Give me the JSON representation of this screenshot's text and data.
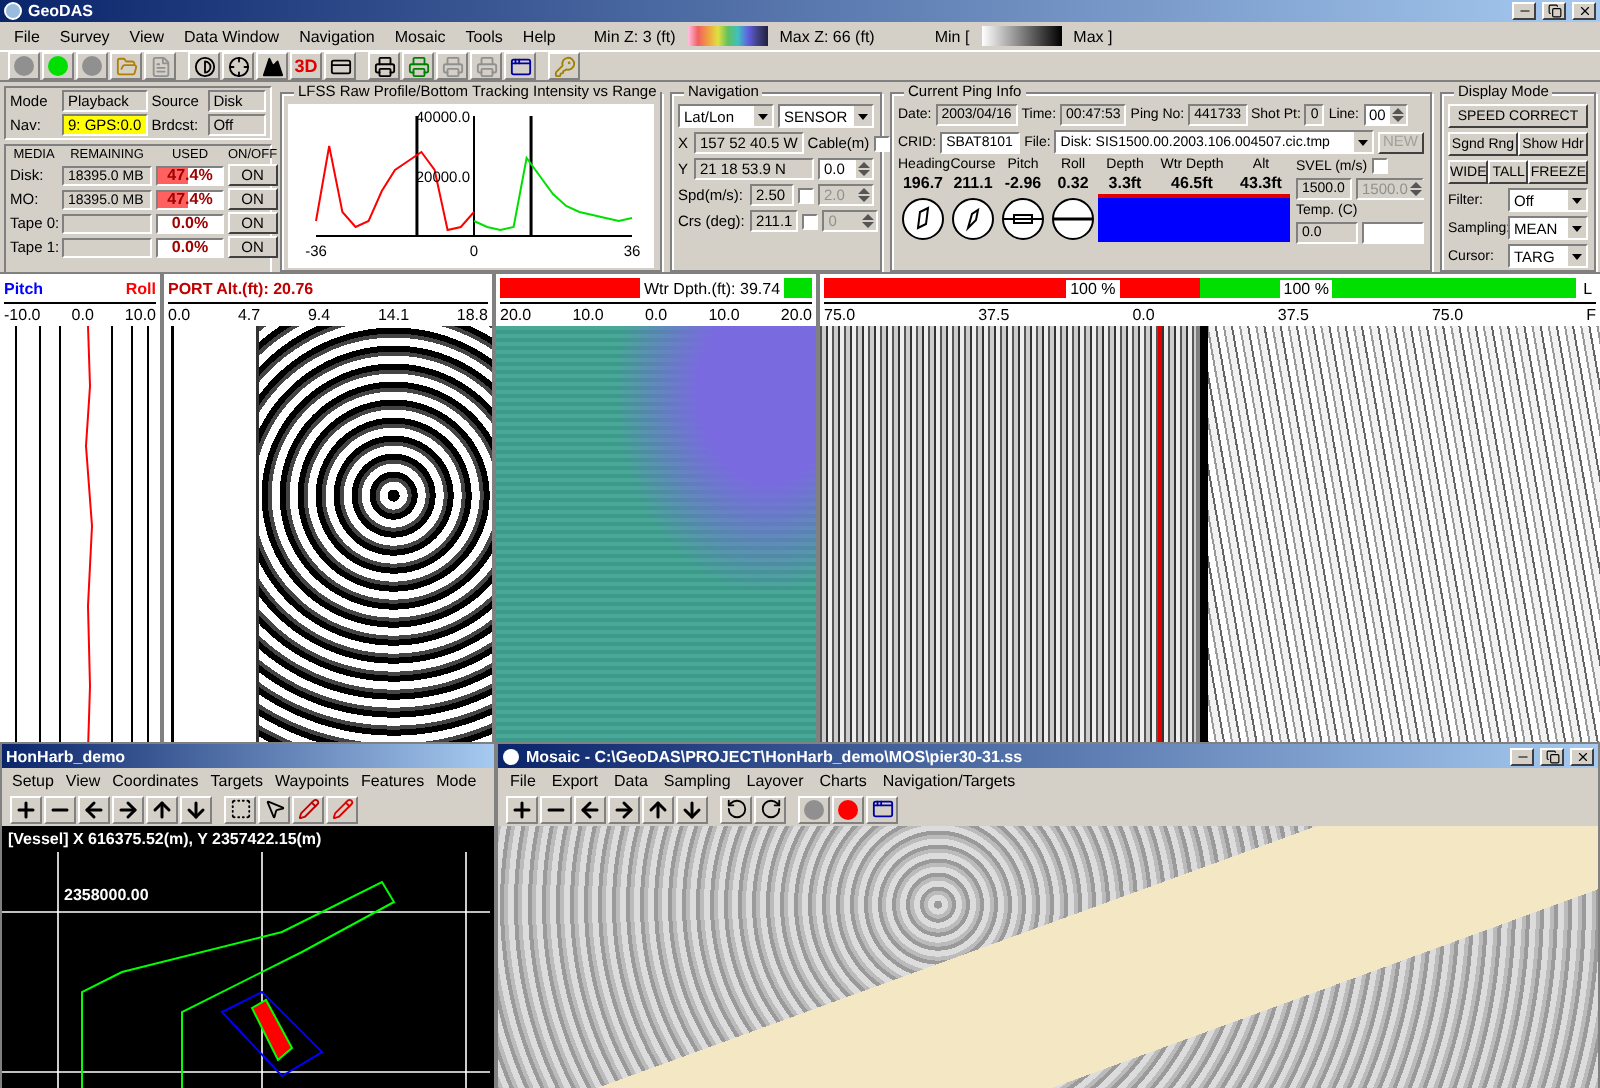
{
  "window": {
    "title": "GeoDAS"
  },
  "menu": [
    "File",
    "Survey",
    "View",
    "Data Window",
    "Navigation",
    "Mosaic",
    "Tools",
    "Help"
  ],
  "depth_scale": {
    "min": "Min Z: 3 (ft)",
    "max": "Max Z: 66 (ft)"
  },
  "intensity_scale": {
    "min": "Min [",
    "max": "Max ]"
  },
  "toolbar": {
    "lights": [
      {
        "on": false
      },
      {
        "on": true
      },
      {
        "on": false
      }
    ],
    "view_3d": "3D"
  },
  "status_fields": [
    {
      "label": "Mode",
      "value": "Playback",
      "highlight": false
    },
    {
      "label": "Source",
      "value": "Disk",
      "highlight": false
    },
    {
      "label": "Nav:",
      "value": "9: GPS:0.0",
      "highlight": true
    },
    {
      "label": "Brdcst:",
      "value": "Off",
      "highlight": false
    }
  ],
  "media": {
    "columns": [
      "MEDIA",
      "REMAINING",
      "USED",
      "ON/OFF"
    ],
    "rows": [
      {
        "name": "Disk:",
        "remaining": "18395.0 MB",
        "used": "47.4%",
        "level": 0.474,
        "toggle": "ON"
      },
      {
        "name": "MO:",
        "remaining": "18395.0 MB",
        "used": "47.4%",
        "level": 0.474,
        "toggle": "ON"
      },
      {
        "name": "Tape 0:",
        "used": "0.0%",
        "level": 0,
        "toggle": "ON"
      },
      {
        "name": "Tape 1:",
        "used": "0.0%",
        "level": 0,
        "toggle": "ON"
      }
    ]
  },
  "profile_chart": {
    "title": "LFSS Raw Profile/Bottom Tracking Intensity vs Range",
    "chart_data": {
      "type": "line",
      "x": [
        -36,
        -33,
        -30,
        -27,
        -24,
        -21,
        -18,
        -15,
        -12,
        -9,
        -6,
        -3,
        0,
        3,
        6,
        9,
        12,
        15,
        18,
        21,
        24,
        27,
        30,
        33,
        36
      ],
      "xlim": [
        -36,
        36
      ],
      "ylim": [
        0,
        40000
      ],
      "xticks": [
        {
          "value": -36,
          "label": "-36"
        },
        {
          "value": 0,
          "label": "0"
        },
        {
          "value": 36,
          "label": "36"
        }
      ],
      "yticks": [
        {
          "value": 20000,
          "label": "20000.0"
        },
        {
          "value": 40000,
          "label": "40000.0"
        }
      ],
      "ref_lines": [
        {
          "axis": "x",
          "value": -13
        },
        {
          "axis": "x",
          "value": 13
        }
      ],
      "series": [
        {
          "color": "#ff0000",
          "values": [
            5000,
            30000,
            8000,
            3000,
            5000,
            15000,
            22000,
            25000,
            28000,
            22000,
            2000,
            3000,
            8000,
            null,
            null,
            null,
            null,
            null,
            null,
            null,
            null,
            null,
            null,
            null,
            null
          ]
        },
        {
          "color": "#00e000",
          "values": [
            null,
            null,
            null,
            null,
            null,
            null,
            null,
            null,
            null,
            null,
            null,
            null,
            5000,
            3000,
            2000,
            3000,
            26000,
            20000,
            14000,
            10000,
            8000,
            7000,
            6000,
            5000,
            6000
          ]
        }
      ]
    }
  },
  "navigation": {
    "title": "Navigation",
    "coord_format": "Lat/Lon",
    "source": "SENSOR",
    "x_label": "X",
    "x": "157 52 40.5  W",
    "y_label": "Y",
    "y": "21 18 53.9  N",
    "cable": {
      "label": "Cable(m)",
      "checked": false,
      "value": "0.0"
    },
    "speed": {
      "label": "Spd(m/s):",
      "value": "2.50",
      "checked": false,
      "override": "2.0"
    },
    "course": {
      "label": "Crs (deg):",
      "value": "211.1",
      "checked": false,
      "override": "0"
    }
  },
  "ping": {
    "title": "Current Ping Info",
    "fields": [
      {
        "label": "Date:",
        "value": "2003/04/16"
      },
      {
        "label": "Time:",
        "value": "00:47:53"
      },
      {
        "label": "Ping No:",
        "value": "441733"
      },
      {
        "label": "Shot Pt:",
        "value": "0"
      }
    ],
    "line": {
      "label": "Line:",
      "value": "00"
    },
    "crid": {
      "label": "CRID:",
      "value": "SBAT8101"
    },
    "file": {
      "label": "File:",
      "value": "Disk: SIS1500.00.2003.106.004507.cic.tmp"
    },
    "new_button": {
      "label": "NEW",
      "disabled": true
    },
    "readings": [
      {
        "label": "Heading",
        "value": "196.7"
      },
      {
        "label": "Course",
        "value": "211.1"
      },
      {
        "label": "Pitch",
        "value": "-2.96"
      },
      {
        "label": "Roll",
        "value": "0.32"
      },
      {
        "label": "Depth",
        "value": "3.3ft"
      },
      {
        "label": "Wtr Depth",
        "value": "46.5ft"
      },
      {
        "label": "Alt",
        "value": "43.3ft"
      }
    ],
    "svel": {
      "label": "SVEL (m/s)",
      "checked": false,
      "value": "1500.0",
      "override": "1500.0"
    },
    "temp": {
      "label": "Temp. (C)",
      "value": "0.0"
    }
  },
  "display_mode": {
    "title": "Display Mode",
    "main_button": "SPEED CORRECT",
    "row_1": [
      "Sgnd Rng",
      "Show Hdr"
    ],
    "row_2": [
      "WIDE",
      "TALL",
      "FREEZE"
    ],
    "selects": [
      {
        "label": "Filter:",
        "value": "Off"
      },
      {
        "label": "Sampling:",
        "value": "MEAN"
      },
      {
        "label": "Cursor:",
        "value": "TARG"
      }
    ]
  },
  "scales": {
    "attitude": {
      "pitch": "Pitch",
      "roll": "Roll",
      "ticks": [
        "-10.0",
        "0.0",
        "10.0"
      ]
    },
    "altitude": {
      "label": "PORT Alt.(ft):  20.76",
      "ticks": [
        "0.0",
        "4.7",
        "9.4",
        "14.1",
        "18.8"
      ]
    },
    "water_depth": {
      "label": "Wtr Dpth.(ft): 39.74",
      "ticks": [
        "20.0",
        "10.0",
        "0.0",
        "10.0",
        "20.0"
      ]
    },
    "sidescan": {
      "port": "100 %",
      "starboard": "100 %",
      "ticks": [
        "75.0",
        "37.5",
        "0.0",
        "37.5",
        "75.0"
      ],
      "side_top": "L",
      "side_bottom": "F"
    }
  },
  "map_window": {
    "title": "HonHarb_demo",
    "menu": [
      "Setup",
      "View",
      "Coordinates",
      "Targets",
      "Waypoints",
      "Features",
      "Mode"
    ],
    "readout": "[Vessel] X 616375.52(m), Y 2357422.15(m)",
    "grid_label": "2358000.00"
  },
  "mosaic_window": {
    "title": "Mosaic - C:\\GeoDAS\\PROJECT\\HonHarb_demo\\MOS\\pier30-31.ss",
    "menu": [
      "File",
      "Export",
      "Data",
      "Sampling",
      "Layover",
      "Charts",
      "Navigation/Targets"
    ],
    "lights": [
      {
        "on": false
      },
      {
        "on": true
      }
    ]
  }
}
